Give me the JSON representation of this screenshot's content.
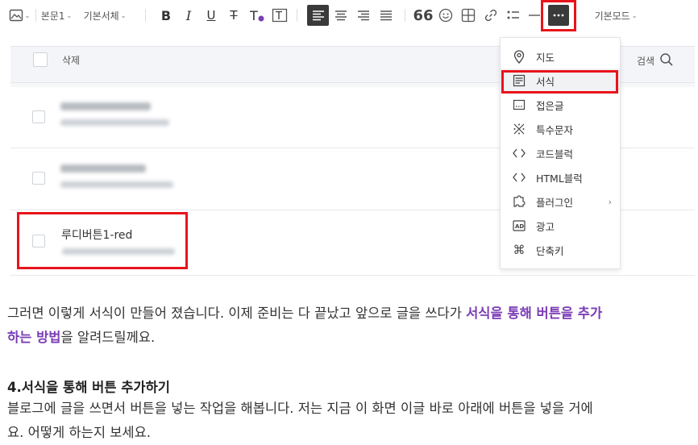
{
  "toolbar": {
    "paragraph_label": "본문1",
    "font_label": "기본서체",
    "mode_label": "기본모드",
    "text_color_accent": "#7b3db5",
    "icons": [
      "image-icon",
      "bold-icon",
      "italic-icon",
      "underline-icon",
      "strikethrough-icon",
      "text-color-icon",
      "text-background-icon",
      "align-left-icon",
      "align-center-icon",
      "align-right-icon",
      "align-justify-icon",
      "quote-icon",
      "emoji-icon",
      "table-icon",
      "link-icon",
      "list-icon",
      "divider-icon",
      "more-icon"
    ]
  },
  "list": {
    "delete_label": "삭제",
    "search_label": "검색",
    "rows": [
      {
        "title": "",
        "blurred": true
      },
      {
        "title": "",
        "blurred": true
      },
      {
        "title": "루디버튼1-red",
        "blurred": false
      }
    ]
  },
  "menu": {
    "items": [
      {
        "label": "지도",
        "icon": "map-pin-icon"
      },
      {
        "label": "서식",
        "icon": "template-icon"
      },
      {
        "label": "접은글",
        "icon": "fold-text-icon"
      },
      {
        "label": "특수문자",
        "icon": "special-char-icon"
      },
      {
        "label": "코드블럭",
        "icon": "code-icon"
      },
      {
        "label": "HTML블럭",
        "icon": "html-icon"
      },
      {
        "label": "플러그인",
        "icon": "plugin-icon"
      },
      {
        "label": "광고",
        "icon": "ad-icon"
      },
      {
        "label": "단축키",
        "icon": "shortcut-icon"
      }
    ]
  },
  "content": {
    "p1_line1_a": "그러면 이렇게 서식이 만들어 졌습니다. 이제 준비는 다 끝났고 앞으로 글을 쓰다가 ",
    "p1_line1_b": "서식을 통해 버튼을 추가",
    "p1_line2_a": "하는 방법",
    "p1_line2_b": "을 알려드릴께요.",
    "heading": "4.서식을 통해 버튼 추가하기",
    "p2_line1": "블로그에 글을 쓰면서 버튼을 넣는 작업을 해봅니다. 저는 지금 이 화면 이글 바로 아래에 버튼을 넣을 거에",
    "p2_line2": "요. 어떻게 하는지 보세요.",
    "highlight_color": "#7b3db5",
    "annotation_color": "#e8141b"
  }
}
